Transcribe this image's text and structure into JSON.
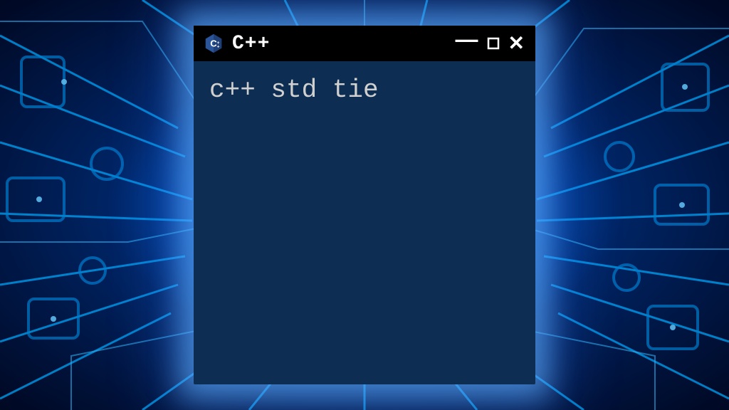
{
  "window": {
    "title": "C++",
    "icon": "cpp-logo-icon"
  },
  "content": {
    "text": "c++ std tie"
  },
  "colors": {
    "window_bg": "#0d2d52",
    "titlebar_bg": "#000000",
    "text": "#d0d0d0",
    "glow": "#4db8ff"
  }
}
